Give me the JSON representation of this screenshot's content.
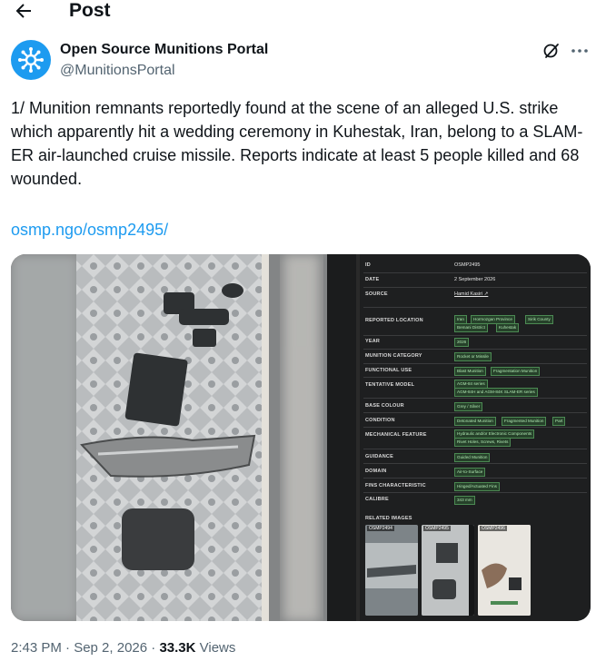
{
  "header": {
    "title": "Post"
  },
  "author": {
    "name": "Open Source Munitions Portal",
    "handle": "@MunitionsPortal"
  },
  "tweet": {
    "text": "1/ Munition remnants reportedly found at the scene of an alleged U.S. strike which apparently hit a wedding ceremony in Kuhestak, Iran, belong to a SLAM-ER air-launched cruise missile. Reports indicate at least 5 people killed and 68 wounded.",
    "link": "osmp.ngo/osmp2495/"
  },
  "card": {
    "id_label": "ID",
    "id_value": "OSMP2495",
    "date_label": "DATE",
    "date_value": "2 September 2026",
    "source_label": "SOURCE",
    "source_value": "Hamid Kasiri ↗",
    "location_label": "REPORTED LOCATION",
    "location_tags": [
      "Iran",
      "Hormozgan Province",
      "Sirik County",
      "Bemani District",
      "Kuhestak"
    ],
    "year_label": "YEAR",
    "year_tags": [
      "2026"
    ],
    "category_label": "MUNITION CATEGORY",
    "category_tags": [
      "Rocket or Missile"
    ],
    "functional_label": "FUNCTIONAL USE",
    "functional_tags": [
      "Blast Munition",
      "Fragmentation Munition"
    ],
    "model_label": "TENTATIVE MODEL",
    "model_tags": [
      "AGM-84 series",
      "AGM-84H and AGM-84K SLAM-ER series"
    ],
    "colour_label": "BASE COLOUR",
    "colour_tags": [
      "Grey / Silver"
    ],
    "condition_label": "CONDITION",
    "condition_tags": [
      "Detonated Munition",
      "Fragmented Munition",
      "Part"
    ],
    "feature_label": "MECHANICAL FEATURE",
    "feature_tags": [
      "Hydraulic and/or Electronic Components",
      "Rivet Holes, Screws, Rivets"
    ],
    "guidance_label": "GUIDANCE",
    "guidance_tags": [
      "Guided Munition"
    ],
    "domain_label": "DOMAIN",
    "domain_tags": [
      "Air-to-Surface"
    ],
    "fins_label": "FINS CHARACTERISTIC",
    "fins_tags": [
      "Hinged/Actuated Fins"
    ],
    "calibre_label": "CALIBRE",
    "calibre_tags": [
      "343 mm"
    ],
    "related_label": "RELATED IMAGES",
    "related": [
      "OSMP2494",
      "OSMP2495",
      "OSMP2496"
    ]
  },
  "meta": {
    "time": "2:43 PM · Sep 2, 2026 · ",
    "views_count": "33.3K",
    "views_label": " Views"
  },
  "colors": {
    "link": "#1d9bf0",
    "muted": "#536471",
    "text": "#0f1419",
    "card_bg": "#1e1f20",
    "tag_bg": "#26412a"
  }
}
